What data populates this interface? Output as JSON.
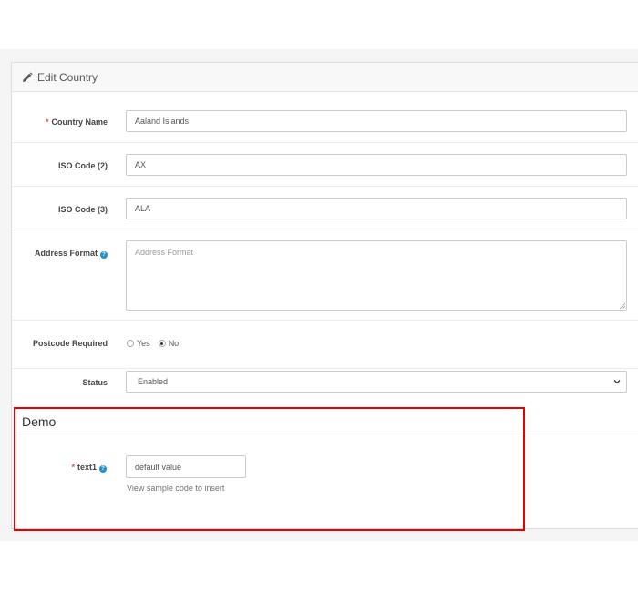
{
  "panel": {
    "title": "Edit Country"
  },
  "form": {
    "required_marker": "*",
    "country_name": {
      "label": "Country Name",
      "value": "Aaland Islands"
    },
    "iso_code_2": {
      "label": "ISO Code (2)",
      "value": "AX"
    },
    "iso_code_3": {
      "label": "ISO Code (3)",
      "value": "ALA"
    },
    "address_format": {
      "label": "Address Format",
      "placeholder": "Address Format",
      "help_icon": "question-circle-icon"
    },
    "postcode_required": {
      "label": "Postcode Required",
      "options": [
        "Yes",
        "No"
      ],
      "selected": "No"
    },
    "status": {
      "label": "Status",
      "value": "Enabled"
    }
  },
  "demo": {
    "legend": "Demo",
    "text1": {
      "label": "text1",
      "value": "default value",
      "hint": "View sample code to insert",
      "help_icon": "question-circle-icon"
    }
  },
  "colors": {
    "required": "#e3503e",
    "help_icon": "#1e91cf",
    "highlight_border": "#e60000"
  }
}
